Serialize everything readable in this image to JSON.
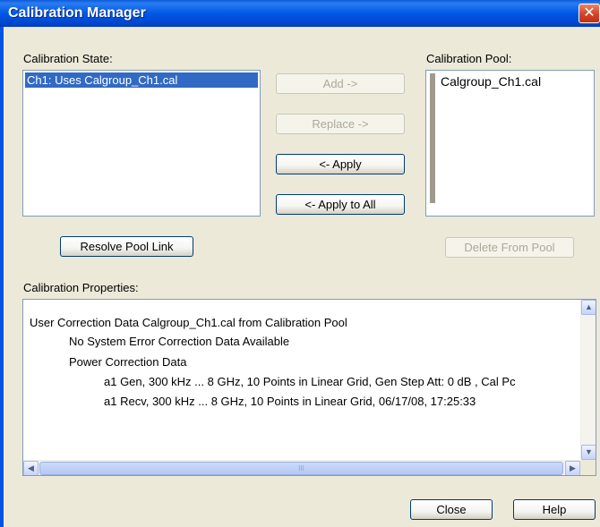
{
  "window": {
    "title": "Calibration Manager",
    "close_glyph": "✕"
  },
  "calibration_state": {
    "label": "Calibration State:",
    "items": [
      "Ch1: Uses Calgroup_Ch1.cal"
    ]
  },
  "calibration_pool": {
    "label": "Calibration Pool:",
    "items": [
      "Calgroup_Ch1.cal"
    ]
  },
  "buttons": {
    "add": "Add ->",
    "replace": "Replace ->",
    "apply": "<- Apply",
    "apply_all": "<- Apply to All",
    "resolve": "Resolve Pool Link",
    "delete": "Delete From Pool",
    "close": "Close",
    "help": "Help"
  },
  "properties": {
    "label": "Calibration Properties:",
    "lines": [
      "User Correction Data Calgroup_Ch1.cal from Calibration Pool",
      "No System Error Correction Data Available",
      "Power Correction Data",
      "a1 Gen, 300 kHz ... 8 GHz, 10 Points in Linear Grid, Gen Step Att: 0 dB , Cal Pc",
      "a1 Recv, 300 kHz ... 8 GHz, 10 Points in Linear Grid, 06/17/08, 17:25:33"
    ]
  },
  "scrollbar": {
    "up": "▲",
    "down": "▼",
    "left": "◀",
    "right": "▶",
    "grip": "III"
  }
}
